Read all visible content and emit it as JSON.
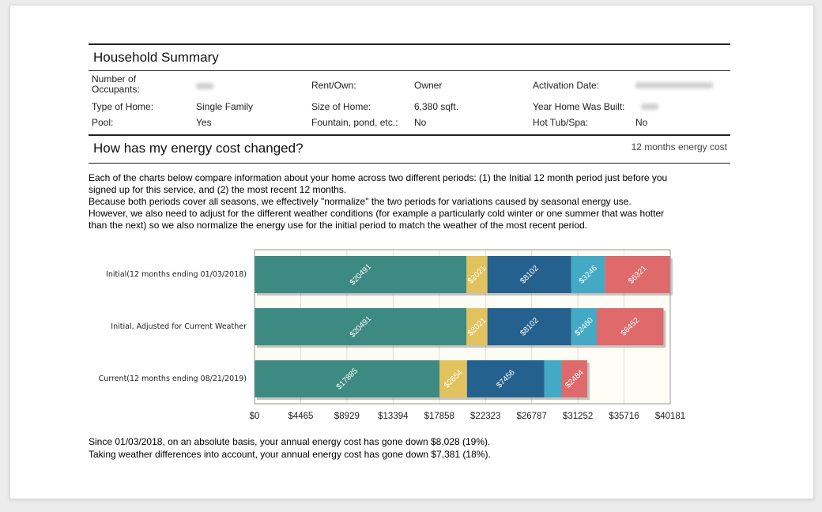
{
  "household": {
    "title": "Household Summary",
    "rows": [
      [
        {
          "label": "Number of Occupants:",
          "value": ""
        },
        {
          "label": "Rent/Own:",
          "value": "Owner"
        },
        {
          "label": "Activation Date:",
          "value": ""
        }
      ],
      [
        {
          "label": "Type of Home:",
          "value": "Single Family"
        },
        {
          "label": "Size of Home:",
          "value": "6,380 sqft."
        },
        {
          "label": "Year Home Was Built:",
          "value": ""
        }
      ],
      [
        {
          "label": "Pool:",
          "value": "Yes"
        },
        {
          "label": "Fountain, pond, etc.:",
          "value": "No"
        },
        {
          "label": "Hot Tub/Spa:",
          "value": "No"
        }
      ]
    ],
    "occupants_label_line1": "Number of",
    "occupants_label_line2": "Occupants:"
  },
  "energy": {
    "title": "How has my energy cost changed?",
    "right_note": "12 months energy cost",
    "intro": [
      "Each of the charts below compare information about your home across two different periods: (1) the Initial 12 month period just before you",
      "signed up for this service, and (2) the most recent 12 months.",
      "Because both periods cover all seasons, we effectively \"normalize\" the two periods for variations caused by seasonal energy use.",
      "However, we also need to adjust for the different weather conditions (for example a particularly cold winter or one summer that was hotter",
      "than the next) so we also normalize the energy use for the initial period to match the weather of the most recent period."
    ],
    "summary": [
      "Since 01/03/2018, on an absolute basis, your annual energy cost has gone down $8,028 (19%).",
      "Taking weather differences into account, your annual energy cost has gone down $7,381 (18%)."
    ]
  },
  "chart_data": {
    "type": "bar",
    "orientation": "horizontal",
    "stacked": true,
    "categories": [
      "Initial(12 months ending 01/03/2018)",
      "Initial, Adjusted for Current Weather",
      "Current(12 months ending 08/21/2019)"
    ],
    "series": [
      {
        "values": [
          20491,
          20491,
          17885
        ],
        "labels": [
          "$20491",
          "$20491",
          "$17885"
        ],
        "color": "#3d8a82"
      },
      {
        "values": [
          2021,
          2021,
          2654
        ],
        "labels": [
          "$2021",
          "$2021",
          "$2654"
        ],
        "color": "#e2c25e"
      },
      {
        "values": [
          8102,
          8102,
          7456
        ],
        "labels": [
          "$8102",
          "$8102",
          "$7456"
        ],
        "color": "#25618f"
      },
      {
        "values": [
          3246,
          2460,
          1684
        ],
        "labels": [
          "$3246",
          "$2460",
          ""
        ],
        "color": "#44a9c4"
      },
      {
        "values": [
          6321,
          6452,
          2484
        ],
        "labels": [
          "$6321",
          "$6452",
          "$2484"
        ],
        "color": "#de6a6c"
      }
    ],
    "xticks": [
      "$0",
      "$4465",
      "$8929",
      "$13394",
      "$17858",
      "$22323",
      "$26787",
      "$31252",
      "$35716",
      "$40181"
    ],
    "xlim": [
      0,
      40181
    ],
    "grid": true,
    "plot_background": "#fdfcf5"
  }
}
